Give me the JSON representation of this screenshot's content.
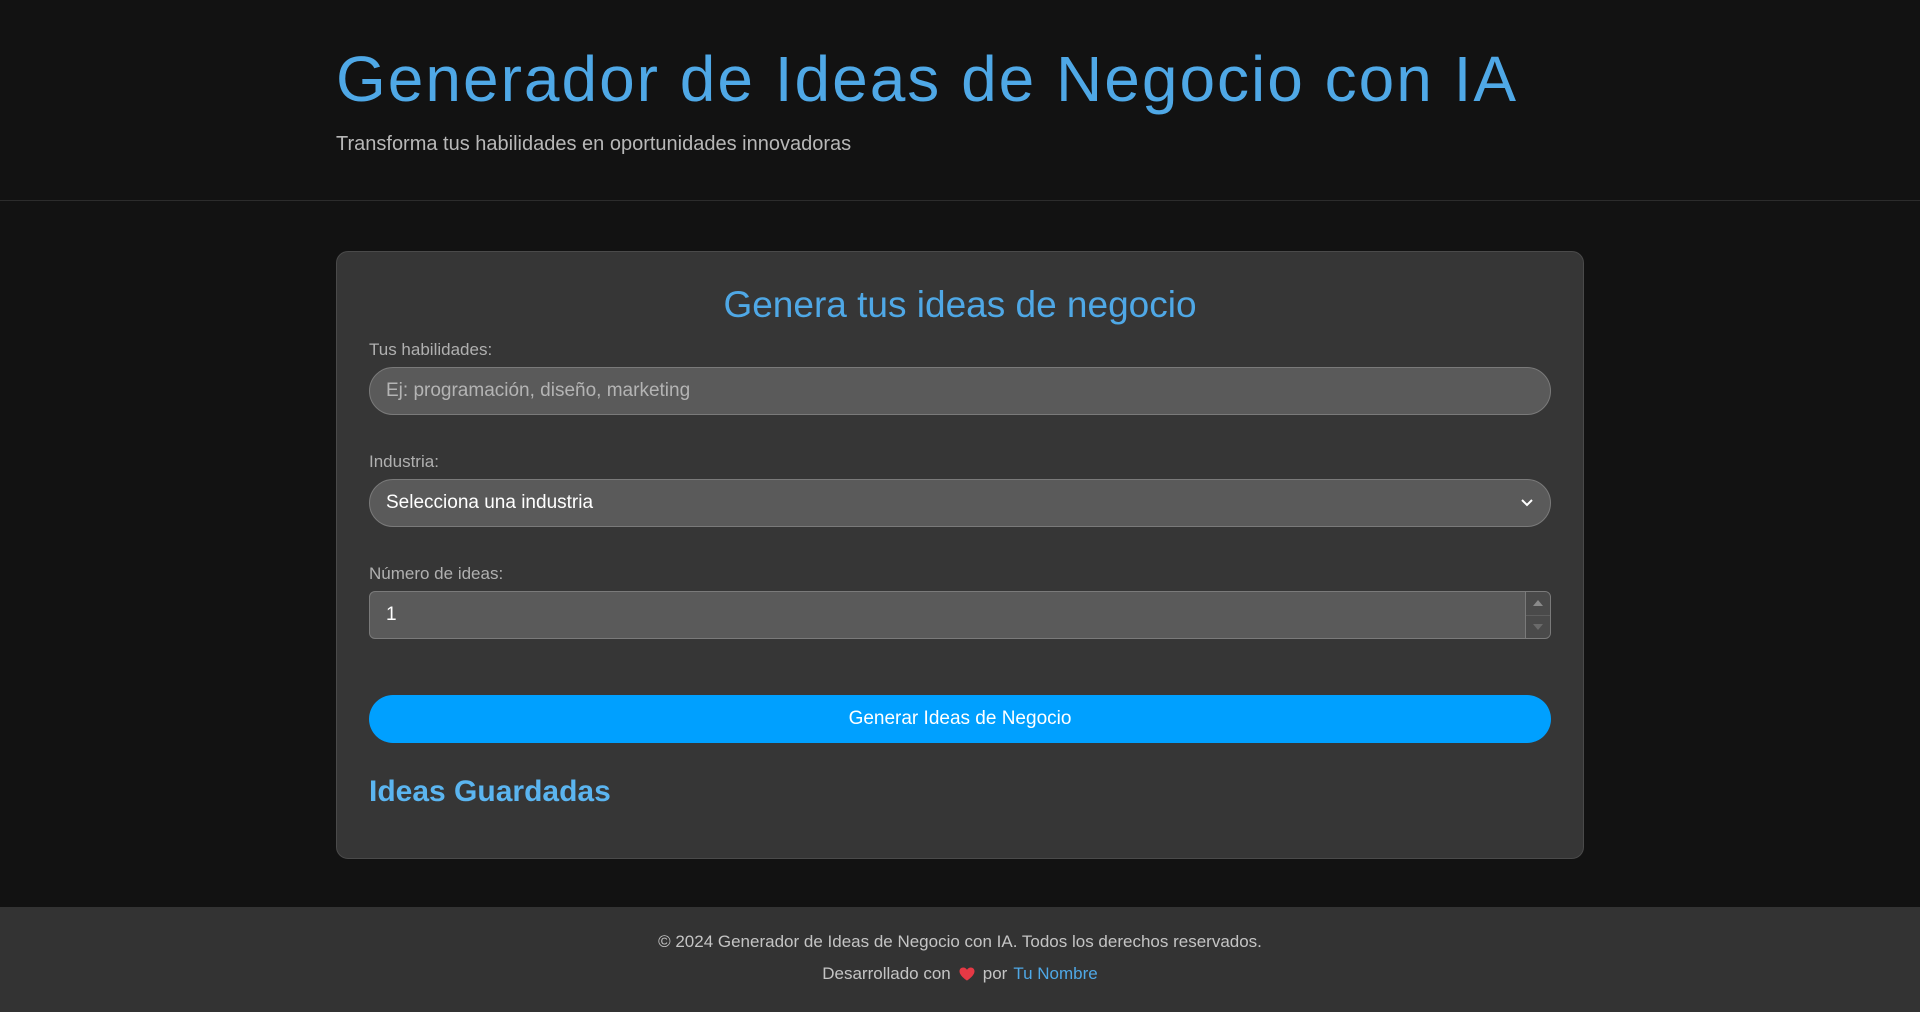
{
  "header": {
    "title": "Generador de Ideas de Negocio con IA",
    "subtitle": "Transforma tus habilidades en oportunidades innovadoras"
  },
  "form": {
    "title": "Genera tus ideas de negocio",
    "skills": {
      "label": "Tus habilidades:",
      "placeholder": "Ej: programación, diseño, marketing",
      "value": ""
    },
    "industry": {
      "label": "Industria:",
      "selected": "Selecciona una industria",
      "icon": "chevron-down-icon"
    },
    "count": {
      "label": "Número de ideas:",
      "value": "1"
    },
    "submit_label": "Generar Ideas de Negocio"
  },
  "saved": {
    "title": "Ideas Guardadas"
  },
  "footer": {
    "copyright": "© 2024 Generador de Ideas de Negocio con IA. Todos los derechos reservados.",
    "made_with": "Desarrollado con",
    "heart_icon": "heart-icon",
    "by": "por",
    "author": "Tu Nombre"
  },
  "colors": {
    "background": "#121212",
    "card": "#363636",
    "accent": "#4fa8e6",
    "button": "#00a0ff",
    "footer": "#333333"
  }
}
